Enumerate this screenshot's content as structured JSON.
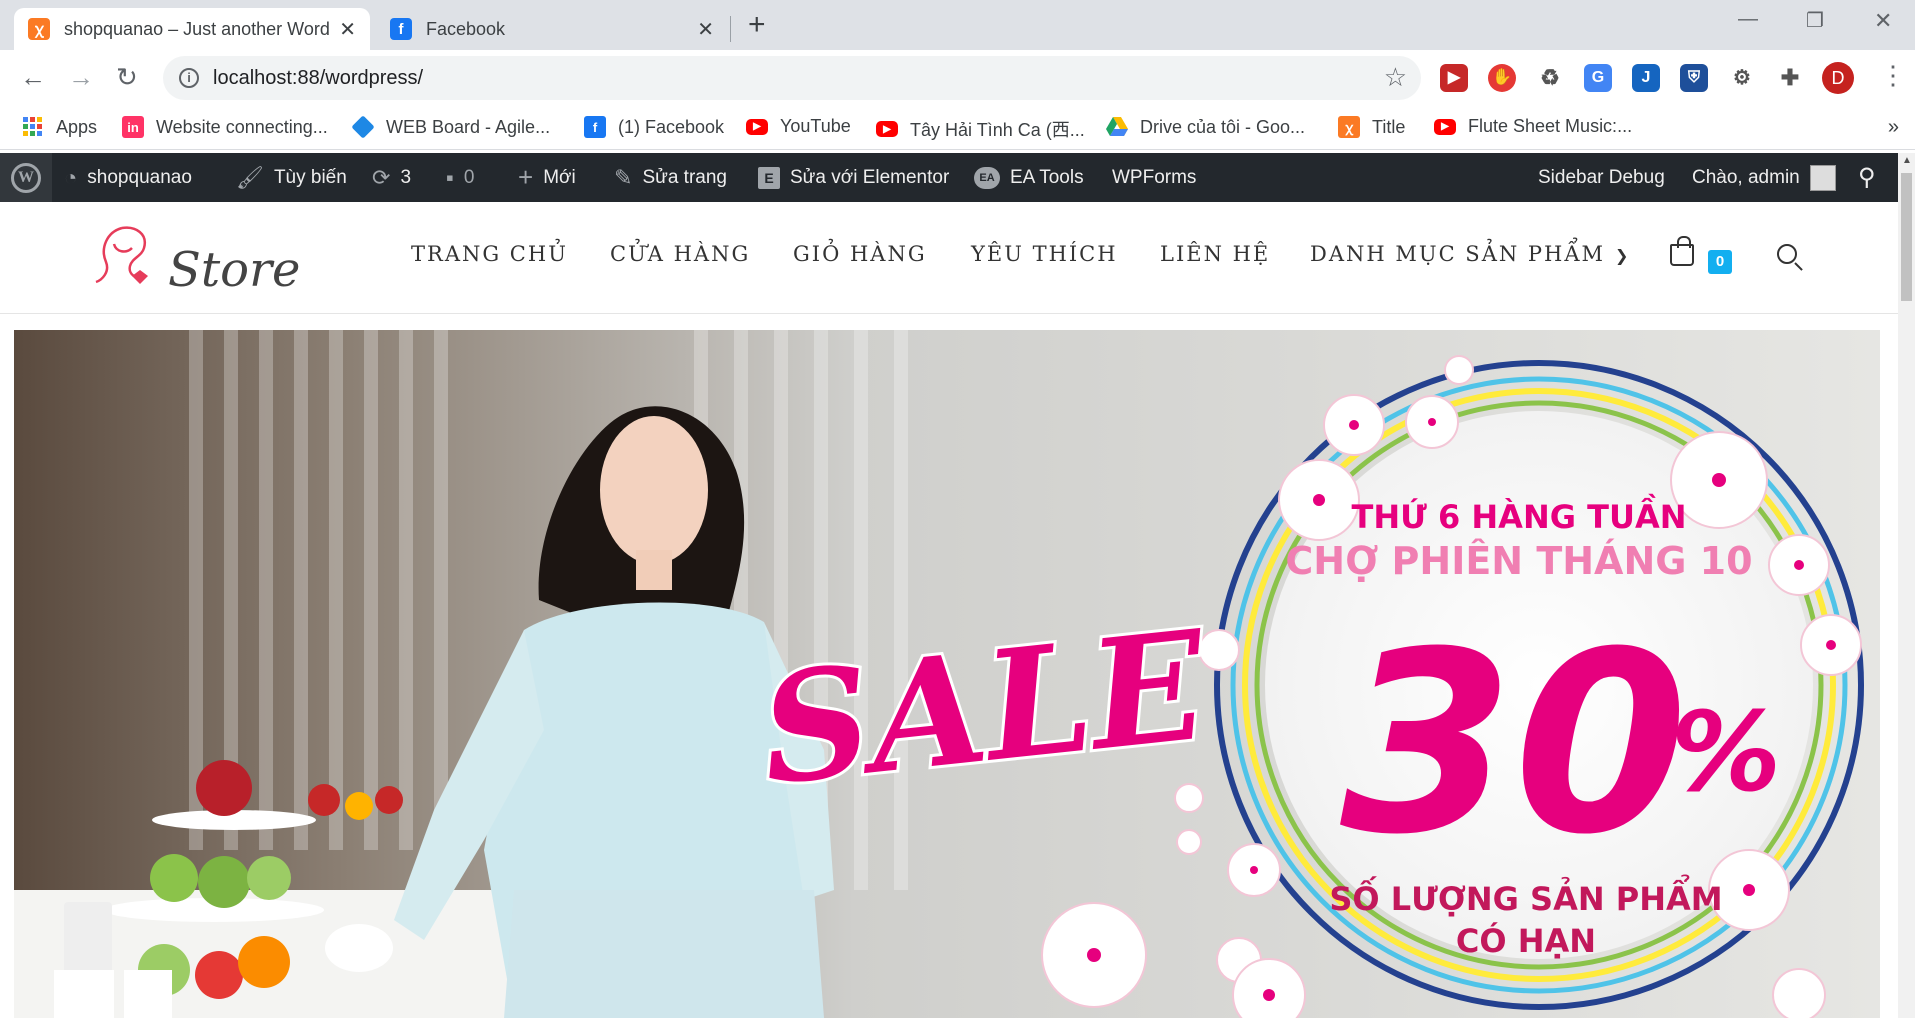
{
  "browser": {
    "tabs": [
      {
        "title": "shopquanao – Just another Word",
        "active": true,
        "favicon": "xampp-icon"
      },
      {
        "title": "Facebook",
        "active": false,
        "favicon": "facebook-icon"
      }
    ],
    "close_glyph": "✕",
    "new_tab_glyph": "+",
    "url": "localhost:88/wordpress/",
    "profile_initial": "D"
  },
  "bookmarks": [
    {
      "label": "Apps",
      "icon": "apps-grid-icon",
      "color": "#4285f4"
    },
    {
      "label": "Website connecting...",
      "icon": "invision-icon",
      "color": "#ff3366"
    },
    {
      "label": "WEB Board - Agile...",
      "icon": "diamond-icon",
      "color": "#1e88e5"
    },
    {
      "label": "(1) Facebook",
      "icon": "facebook-icon",
      "color": "#1877f2"
    },
    {
      "label": "YouTube",
      "icon": "youtube-icon",
      "color": "#ff0000"
    },
    {
      "label": "Tây Hải Tình Ca (西...",
      "icon": "youtube-icon",
      "color": "#ff0000"
    },
    {
      "label": "Drive của tôi - Goo...",
      "icon": "drive-icon",
      "color": "#1fa463"
    },
    {
      "label": "Title",
      "icon": "xampp-icon",
      "color": "#fb7a24"
    },
    {
      "label": "Flute Sheet Music:...",
      "icon": "youtube-icon",
      "color": "#ff0000"
    }
  ],
  "adminbar": {
    "site_name": "shopquanao",
    "customize": "Tùy biến",
    "updates": "3",
    "comments": "0",
    "new": "Mới",
    "edit_page": "Sửa trang",
    "elementor": "Sửa với Elementor",
    "ea_tools": "EA Tools",
    "wpforms": "WPForms",
    "sidebar_debug": "Sidebar Debug",
    "greeting": "Chào, admin"
  },
  "site": {
    "logo_word": "Store",
    "menu": [
      "TRANG CHỦ",
      "CỬA HÀNG",
      "GIỎ HÀNG",
      "YÊU THÍCH",
      "LIÊN HỆ",
      "DANH MỤC SẢN PHẨM"
    ],
    "cart_count": "0"
  },
  "banner": {
    "line1": "THỨ 6 HÀNG TUẦN",
    "line2": "CHỢ PHIÊN THÁNG 10",
    "sale": "SALE",
    "percent_number": "30",
    "percent_sign": "%",
    "line3": "SỐ LƯỢNG SẢN PHẨM",
    "line4": "CÓ HẠN",
    "accent_color": "#e6007e",
    "pink_light": "#f07fb2"
  }
}
